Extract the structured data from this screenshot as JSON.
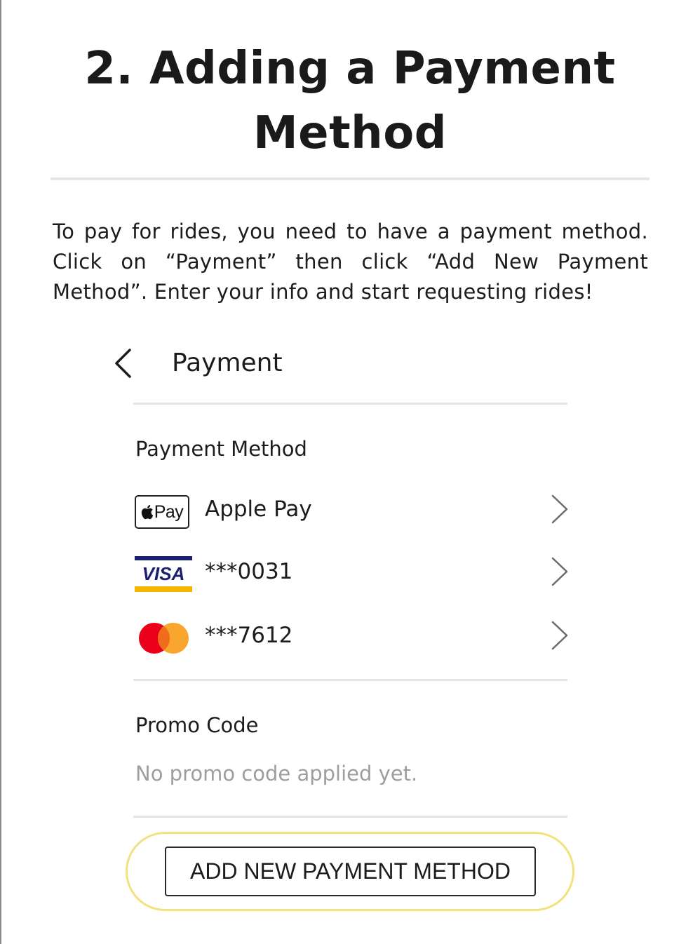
{
  "document": {
    "title": "2. Adding a Payment Method",
    "instructions": "To pay for rides, you need to have a payment method. Click on “Payment” then click “Add New Payment Method”. Enter your info and start requesting rides!"
  },
  "screen": {
    "title": "Payment",
    "back_icon": "chevron-left-icon"
  },
  "payment_methods": {
    "heading": "Payment Method",
    "items": [
      {
        "brand": "Apple Pay",
        "badge_text": "Pay",
        "label": "Apple Pay",
        "icon": "apple-pay-icon"
      },
      {
        "brand": "Visa",
        "badge_text": "VISA",
        "label": "***0031",
        "icon": "visa-icon",
        "colors": {
          "blue": "#1a1f71",
          "gold": "#f7b600"
        }
      },
      {
        "brand": "Mastercard",
        "label": "***7612",
        "icon": "mastercard-icon",
        "colors": {
          "red": "#eb001b",
          "orange": "#f79e1b"
        }
      }
    ]
  },
  "promo": {
    "heading": "Promo Code",
    "status": "No promo code applied yet."
  },
  "actions": {
    "add_payment_method": "ADD NEW PAYMENT METHOD",
    "highlight_color": "#f2e27d"
  }
}
